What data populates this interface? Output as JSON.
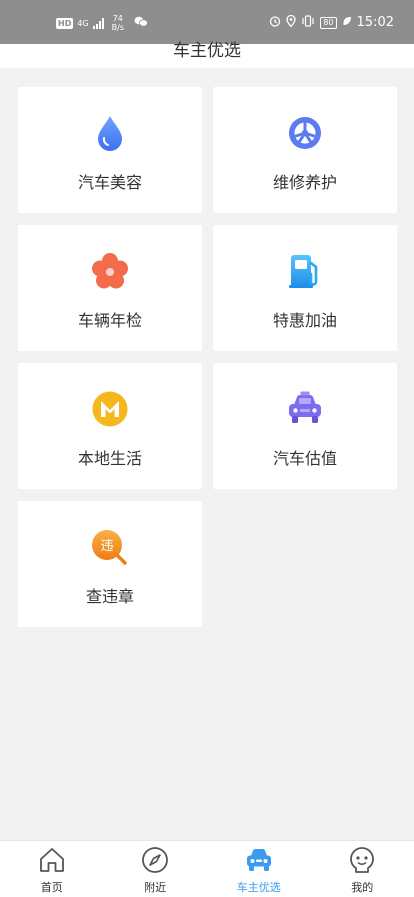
{
  "status_bar": {
    "hd": "HD",
    "network": "4G",
    "speed_value": "74",
    "speed_unit": "B/s",
    "battery": "80",
    "time": "15:02"
  },
  "header": {
    "title": "车主优选"
  },
  "grid": [
    {
      "label": "汽车美容",
      "icon": "water-drop-icon",
      "color": "#4a86f5"
    },
    {
      "label": "维修养护",
      "icon": "wheel-icon",
      "color": "#5b7cf0"
    },
    {
      "label": "车辆年检",
      "icon": "flower-icon",
      "color": "#f26b4b"
    },
    {
      "label": "特惠加油",
      "icon": "fuel-pump-icon",
      "color": "#2aa9f0"
    },
    {
      "label": "本地生活",
      "icon": "local-life-icon",
      "color": "#f5b61e"
    },
    {
      "label": "汽车估值",
      "icon": "car-valuation-icon",
      "color": "#7b6cf0"
    },
    {
      "label": "查违章",
      "icon": "violation-search-icon",
      "color": "#f29024",
      "badge": "违"
    }
  ],
  "tabbar": {
    "items": [
      {
        "label": "首页",
        "icon": "home-icon",
        "active": false
      },
      {
        "label": "附近",
        "icon": "compass-icon",
        "active": false
      },
      {
        "label": "车主优选",
        "icon": "car-icon",
        "active": true
      },
      {
        "label": "我的",
        "icon": "profile-icon",
        "active": false
      }
    ],
    "active_color": "#3a9bf0"
  }
}
